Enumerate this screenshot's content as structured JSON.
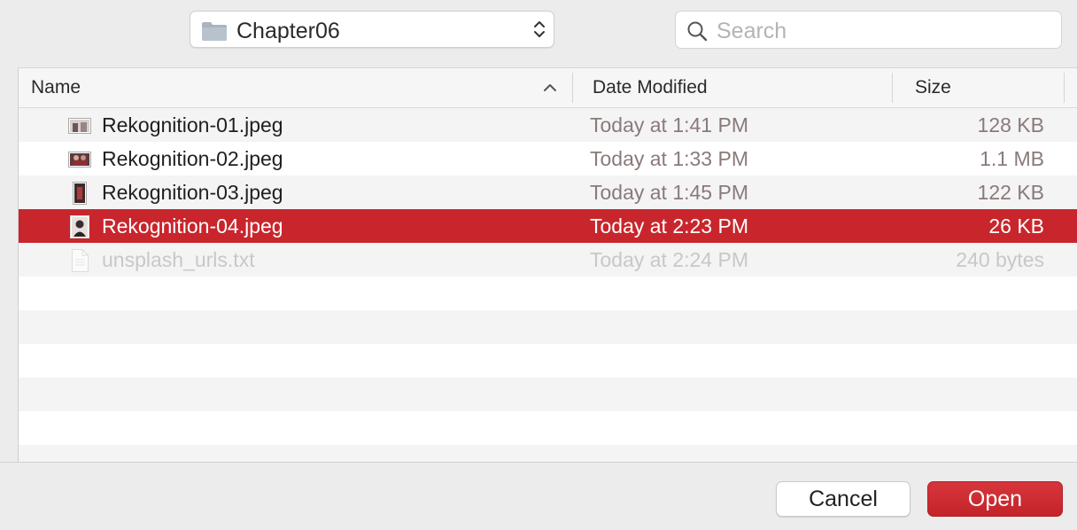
{
  "toolbar": {
    "location": "Chapter06",
    "location_icon": "folder-icon",
    "search_placeholder": "Search",
    "search_value": ""
  },
  "columns": {
    "name": "Name",
    "date": "Date Modified",
    "size": "Size",
    "sort": "name-ascending"
  },
  "files": [
    {
      "name": "Rekognition-01.jpeg",
      "date": "Today at 1:41 PM",
      "size": "128 KB",
      "icon": "jpeg-thumbnail-icon",
      "state": "normal"
    },
    {
      "name": "Rekognition-02.jpeg",
      "date": "Today at 1:33 PM",
      "size": "1.1 MB",
      "icon": "jpeg-thumbnail-icon",
      "state": "normal"
    },
    {
      "name": "Rekognition-03.jpeg",
      "date": "Today at 1:45 PM",
      "size": "122 KB",
      "icon": "jpeg-thumbnail-icon",
      "state": "normal"
    },
    {
      "name": "Rekognition-04.jpeg",
      "date": "Today at 2:23 PM",
      "size": "26 KB",
      "icon": "jpeg-thumbnail-icon",
      "state": "selected"
    },
    {
      "name": "unsplash_urls.txt",
      "date": "Today at 2:24 PM",
      "size": "240 bytes",
      "icon": "text-document-icon",
      "state": "disabled"
    }
  ],
  "buttons": {
    "cancel": "Cancel",
    "open": "Open"
  },
  "colors": {
    "selection": "#c8262c",
    "accent_button": "#c8262c"
  }
}
